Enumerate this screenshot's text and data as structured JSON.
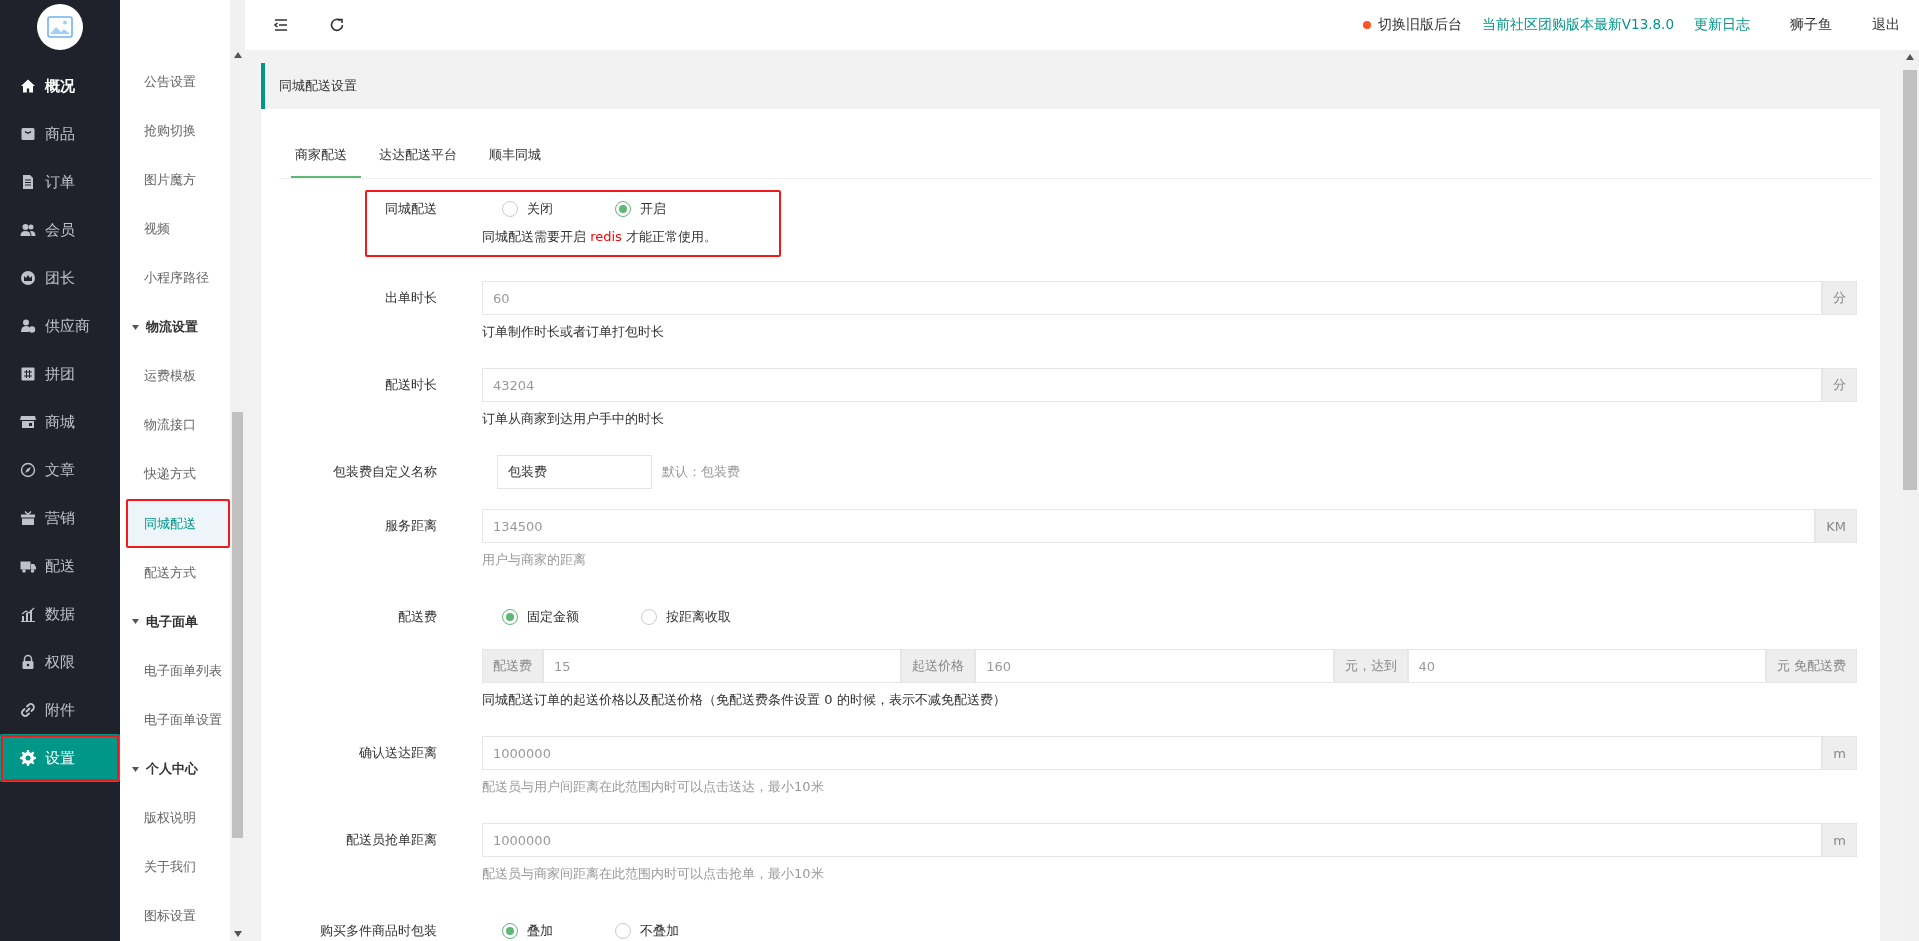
{
  "topbar": {
    "links": [
      {
        "text": "切换旧版后台",
        "kind": "dot"
      },
      {
        "text": "当前社区团购版本最新V13.8.0",
        "kind": "accent"
      },
      {
        "text": "更新日志",
        "kind": "accent"
      },
      {
        "text": "狮子鱼",
        "kind": "plain"
      },
      {
        "text": "退出",
        "kind": "plain"
      }
    ]
  },
  "nav": [
    {
      "label": "概况",
      "highlighted": true,
      "selected": false,
      "outlined": false
    },
    {
      "label": "商品",
      "highlighted": false,
      "selected": false,
      "outlined": false
    },
    {
      "label": "订单",
      "highlighted": false,
      "selected": false,
      "outlined": false
    },
    {
      "label": "会员",
      "highlighted": false,
      "selected": false,
      "outlined": false
    },
    {
      "label": "团长",
      "highlighted": false,
      "selected": false,
      "outlined": false
    },
    {
      "label": "供应商",
      "highlighted": false,
      "selected": false,
      "outlined": false
    },
    {
      "label": "拼团",
      "highlighted": false,
      "selected": false,
      "outlined": false
    },
    {
      "label": "商城",
      "highlighted": false,
      "selected": false,
      "outlined": false
    },
    {
      "label": "文章",
      "highlighted": false,
      "selected": false,
      "outlined": false
    },
    {
      "label": "营销",
      "highlighted": false,
      "selected": false,
      "outlined": false
    },
    {
      "label": "配送",
      "highlighted": false,
      "selected": false,
      "outlined": false
    },
    {
      "label": "数据",
      "highlighted": false,
      "selected": false,
      "outlined": false
    },
    {
      "label": "权限",
      "highlighted": false,
      "selected": false,
      "outlined": false
    },
    {
      "label": "附件",
      "highlighted": false,
      "selected": false,
      "outlined": false
    },
    {
      "label": "设置",
      "highlighted": false,
      "selected": true,
      "outlined": true
    }
  ],
  "submenu": [
    {
      "label": "公告设置",
      "kind": "item",
      "selected": false,
      "outlined": false
    },
    {
      "label": "抢购切换",
      "kind": "item",
      "selected": false,
      "outlined": false
    },
    {
      "label": "图片魔方",
      "kind": "item",
      "selected": false,
      "outlined": false
    },
    {
      "label": "视频",
      "kind": "item",
      "selected": false,
      "outlined": false
    },
    {
      "label": "小程序路径",
      "kind": "item",
      "selected": false,
      "outlined": false
    },
    {
      "label": "物流设置",
      "kind": "group"
    },
    {
      "label": "运费模板",
      "kind": "item",
      "selected": false,
      "outlined": false
    },
    {
      "label": "物流接口",
      "kind": "item",
      "selected": false,
      "outlined": false
    },
    {
      "label": "快递方式",
      "kind": "item",
      "selected": false,
      "outlined": false
    },
    {
      "label": "同城配送",
      "kind": "item",
      "selected": true,
      "outlined": true
    },
    {
      "label": "配送方式",
      "kind": "item",
      "selected": false,
      "outlined": false
    },
    {
      "label": "电子面单",
      "kind": "group"
    },
    {
      "label": "电子面单列表",
      "kind": "item",
      "selected": false,
      "outlined": false
    },
    {
      "label": "电子面单设置",
      "kind": "item",
      "selected": false,
      "outlined": false
    },
    {
      "label": "个人中心",
      "kind": "group"
    },
    {
      "label": "版权说明",
      "kind": "item",
      "selected": false,
      "outlined": false
    },
    {
      "label": "关于我们",
      "kind": "item",
      "selected": false,
      "outlined": false
    },
    {
      "label": "图标设置",
      "kind": "item",
      "selected": false,
      "outlined": false
    }
  ],
  "card": {
    "title": "同城配送设置",
    "tabs": [
      {
        "label": "商家配送",
        "selected": true
      },
      {
        "label": "达达配送平台",
        "selected": false
      },
      {
        "label": "顺丰同城",
        "selected": false
      }
    ],
    "rows": [
      {
        "kind": "radio",
        "label": "同城配送",
        "outlined": true,
        "options": [
          {
            "label": "关闭",
            "selected": false
          },
          {
            "label": "开启",
            "selected": true
          }
        ],
        "note": {
          "before": "同城配送需要开启",
          "highlight": "redis",
          "after": "才能正常使用。"
        }
      },
      {
        "kind": "input",
        "label": "出单时长",
        "value": "60",
        "suffix": "分",
        "hint": {
          "text": "订单制作时长或者订单打包时长",
          "kind": "note"
        }
      },
      {
        "kind": "input",
        "label": "配送时长",
        "value": "43204",
        "suffix": "分",
        "hint": {
          "text": "订单从商家到达用户手中的时长",
          "kind": "note"
        }
      },
      {
        "kind": "short",
        "label": "包装费自定义名称",
        "value": "包装费",
        "aside": "默认：包装费"
      },
      {
        "kind": "input",
        "label": "服务距离",
        "value": "134500",
        "suffix": "KM",
        "hint": {
          "text": "用户与商家的距离",
          "kind": "help"
        }
      },
      {
        "kind": "radio",
        "label": "配送费",
        "outlined": false,
        "options": [
          {
            "label": "固定金额",
            "selected": true
          },
          {
            "label": "按距离收取",
            "selected": false
          }
        ]
      },
      {
        "kind": "group",
        "fields": [
          {
            "addon": "配送费",
            "value": "15"
          },
          {
            "addon": "起送价格",
            "value": "160"
          },
          {
            "addon": "元，达到",
            "value": "40"
          }
        ],
        "suffix": "元 免配送费",
        "hint": {
          "text": "同城配送订单的起送价格以及配送价格（免配送费条件设置 0 的时候，表示不减免配送费）",
          "kind": "note"
        }
      },
      {
        "kind": "input",
        "label": "确认送达距离",
        "value": "1000000",
        "suffix": "m",
        "hint": {
          "text": "配送员与用户间距离在此范围内时可以点击送达，最小10米",
          "kind": "help"
        }
      },
      {
        "kind": "input",
        "label": "配送员抢单距离",
        "value": "1000000",
        "suffix": "m",
        "hint": {
          "text": "配送员与商家间距离在此范围内时可以点击抢单，最小10米",
          "kind": "help"
        }
      },
      {
        "kind": "radio",
        "label": "购买多件商品时包装",
        "outlined": false,
        "options": [
          {
            "label": "叠加",
            "selected": true
          },
          {
            "label": "不叠加",
            "selected": false
          }
        ]
      }
    ]
  }
}
